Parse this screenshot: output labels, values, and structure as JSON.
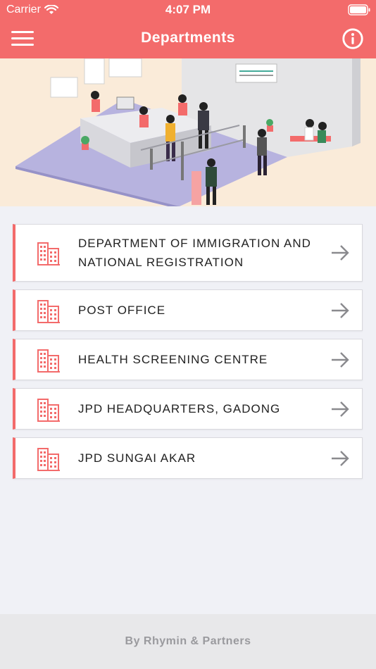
{
  "status_bar": {
    "carrier": "Carrier",
    "time": "4:07 PM"
  },
  "header": {
    "title": "Departments",
    "menu_icon": "hamburger-menu-icon",
    "info_icon": "info-icon"
  },
  "colors": {
    "accent": "#f36b6b",
    "hero_bg": "#faebd9",
    "background": "#f0f1f6"
  },
  "departments": [
    {
      "label": "DEPARTMENT OF IMMIGRATION AND NATIONAL REGISTRATION",
      "icon": "building-icon"
    },
    {
      "label": "POST OFFICE",
      "icon": "building-icon"
    },
    {
      "label": "HEALTH SCREENING CENTRE",
      "icon": "building-icon"
    },
    {
      "label": "JPD HEADQUARTERS, GADONG",
      "icon": "building-icon"
    },
    {
      "label": "JPD SUNGAI AKAR",
      "icon": "building-icon"
    }
  ],
  "footer": {
    "credit": "By Rhymin & Partners"
  }
}
